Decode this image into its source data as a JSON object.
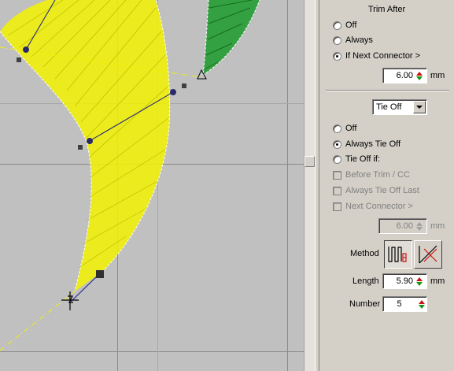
{
  "panel": {
    "trim_after": {
      "title": "Trim After",
      "options": [
        {
          "label": "Off",
          "checked": false
        },
        {
          "label": "Always",
          "checked": false
        },
        {
          "label": "If Next Connector >",
          "checked": true
        }
      ],
      "distance_value": "6.00",
      "distance_unit": "mm"
    },
    "tie_off": {
      "dropdown_value": "Tie Off",
      "options": [
        {
          "label": "Off",
          "checked": false
        },
        {
          "label": "Always Tie Off",
          "checked": true
        },
        {
          "label": "Tie Off if:",
          "checked": false
        }
      ],
      "conditions": [
        {
          "label": "Before Trim / CC",
          "checked": false
        },
        {
          "label": "Always Tie Off Last",
          "checked": false
        },
        {
          "label": "Next Connector >",
          "checked": false
        }
      ],
      "distance_value": "6.00",
      "distance_unit": "mm",
      "method_label": "Method",
      "length_label": "Length",
      "length_value": "5.90",
      "length_unit": "mm",
      "number_label": "Number",
      "number_value": "5"
    }
  },
  "colors": {
    "canvas_bg": "#c0c0c0",
    "yellow_stitch": "#f2f200",
    "green_stitch": "#1a9a2a",
    "spin_up": "#cc1111",
    "spin_down": "#119911"
  },
  "icons": [
    "tie-off-method-1-icon",
    "tie-off-method-2-icon",
    "start-crosshair-icon"
  ]
}
